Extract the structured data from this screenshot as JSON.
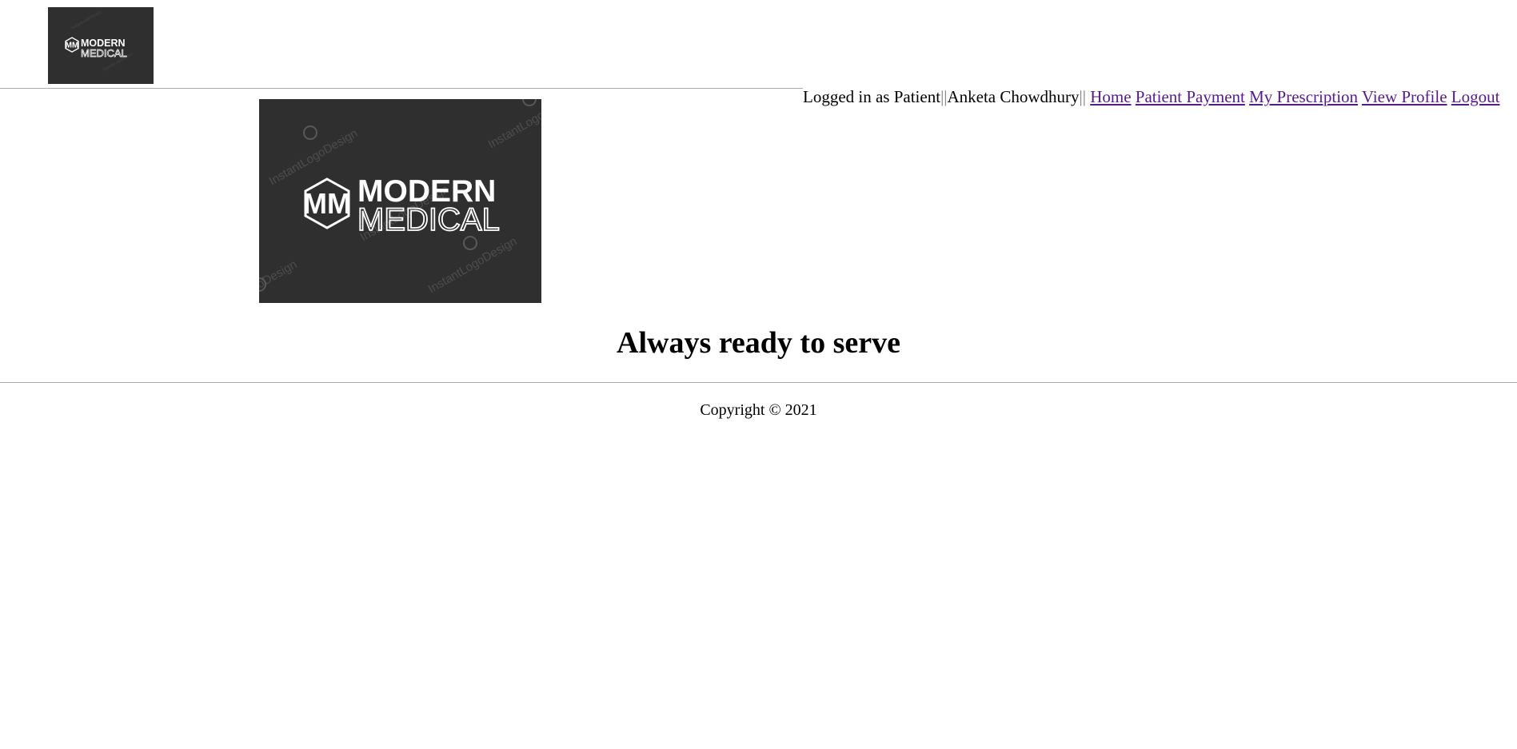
{
  "header": {
    "logo": {
      "line1": "MODERN",
      "line2": "MEDICAL",
      "monogram": "MM",
      "watermark": "InstantLogoDesign"
    }
  },
  "nav": {
    "login_prefix": "Logged in as Patient",
    "separator": "||",
    "user_name": "Anketa Chowdhury",
    "links": [
      {
        "label": "Home"
      },
      {
        "label": "Patient Payment"
      },
      {
        "label": "My Prescription"
      },
      {
        "label": "View Profile"
      },
      {
        "label": "Logout"
      }
    ]
  },
  "hero": {
    "logo": {
      "line1": "MODERN",
      "line2": "MEDICAL",
      "monogram": "MM",
      "watermark": "InstantLogoDesign"
    }
  },
  "main": {
    "headline": "Always ready to serve"
  },
  "footer": {
    "copyright": "Copyright © 2021"
  },
  "colors": {
    "logo_bg": "#2f2f2f",
    "link": "#551a8b",
    "rule": "#a8a8a8"
  }
}
